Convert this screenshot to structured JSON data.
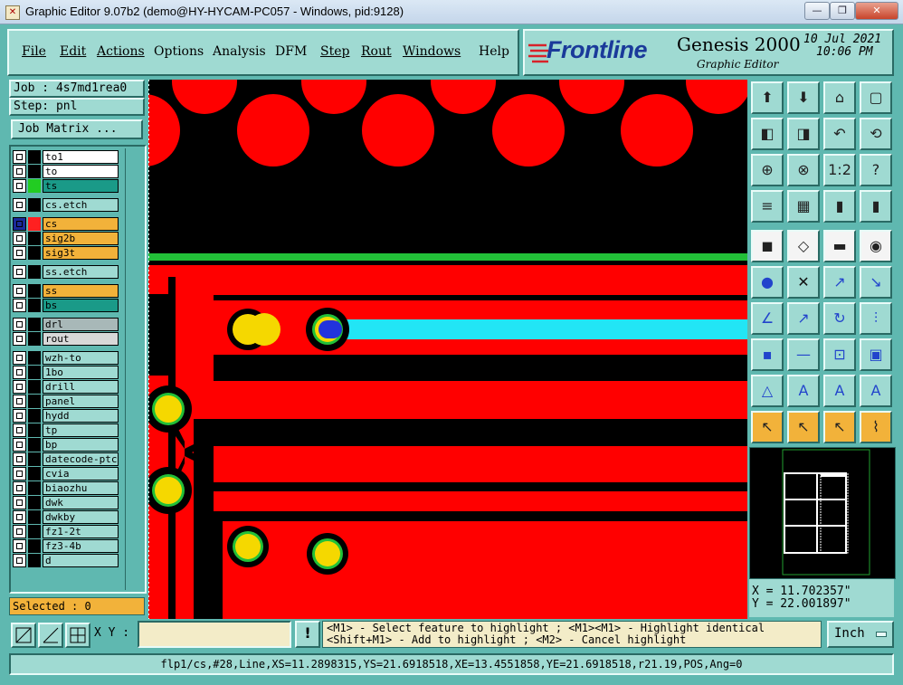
{
  "window": {
    "title": "Graphic Editor 9.07b2 (demo@HY-HYCAM-PC057 - Windows, pid:9128)"
  },
  "menu": {
    "file": "File",
    "edit": "Edit",
    "actions": "Actions",
    "options": "Options",
    "analysis": "Analysis",
    "dfm": "DFM",
    "step": "Step",
    "rout": "Rout",
    "windows": "Windows",
    "help": "Help"
  },
  "brand": {
    "logo": "Frontline",
    "product": "Genesis 2000",
    "subtitle": "Graphic Editor",
    "date": "10 Jul 2021",
    "time": "10:06 PM"
  },
  "job": {
    "job_label": "Job : 4s7md1rea0",
    "step_label": "Step: pnl",
    "matrix_button": "Job Matrix ..."
  },
  "layers": [
    {
      "name": "to1",
      "color": "#000000",
      "bg": "#ffffff"
    },
    {
      "name": "to",
      "color": "#000000",
      "bg": "#ffffff"
    },
    {
      "name": "ts",
      "color": "#22cc22",
      "bg": "#1a9a88"
    },
    {
      "name": "cs.etch",
      "color": "#000000",
      "bg": "#9fdad2"
    },
    {
      "name": "cs",
      "color": "#ff2020",
      "bg": "#f2b23a",
      "active": true
    },
    {
      "name": "sig2b",
      "color": "#000000",
      "bg": "#f2b23a"
    },
    {
      "name": "sig3t",
      "color": "#000000",
      "bg": "#f2b23a"
    },
    {
      "name": "ss.etch",
      "color": "#000000",
      "bg": "#9fdad2"
    },
    {
      "name": "ss",
      "color": "#000000",
      "bg": "#f2b23a"
    },
    {
      "name": "bs",
      "color": "#000000",
      "bg": "#1a9a88"
    },
    {
      "name": "drl",
      "color": "#000000",
      "bg": "#a8b8b8"
    },
    {
      "name": "rout",
      "color": "#000000",
      "bg": "#d8d8d8"
    },
    {
      "name": "wzh-to",
      "color": "#000000",
      "bg": "#9fdad2"
    },
    {
      "name": "1bo",
      "color": "#000000",
      "bg": "#9fdad2"
    },
    {
      "name": "drill",
      "color": "#000000",
      "bg": "#9fdad2"
    },
    {
      "name": "panel",
      "color": "#000000",
      "bg": "#9fdad2"
    },
    {
      "name": "hydd",
      "color": "#000000",
      "bg": "#9fdad2"
    },
    {
      "name": "tp",
      "color": "#000000",
      "bg": "#9fdad2"
    },
    {
      "name": "bp",
      "color": "#000000",
      "bg": "#9fdad2"
    },
    {
      "name": "datecode-ptc",
      "color": "#000000",
      "bg": "#9fdad2"
    },
    {
      "name": "cvia",
      "color": "#000000",
      "bg": "#9fdad2"
    },
    {
      "name": "biaozhu",
      "color": "#000000",
      "bg": "#9fdad2"
    },
    {
      "name": "dwk",
      "color": "#000000",
      "bg": "#9fdad2"
    },
    {
      "name": "dwkby",
      "color": "#000000",
      "bg": "#9fdad2"
    },
    {
      "name": "fz1-2t",
      "color": "#000000",
      "bg": "#9fdad2"
    },
    {
      "name": "fz3-4b",
      "color": "#000000",
      "bg": "#9fdad2"
    },
    {
      "name": "d",
      "color": "#000000",
      "bg": "#9fdad2"
    }
  ],
  "selected": "Selected : 0",
  "coords": {
    "x": "X  =  11.702357\"",
    "y": "Y  =  22.001897\""
  },
  "xy_label": "X Y :",
  "xy_value": "",
  "hint": {
    "line1": "<M1> - Select feature to highlight ; <M1><M1> - Highlight identical",
    "line2": "<Shift+M1> - Add to highlight ; <M2> - Cancel highlight"
  },
  "units": "Inch",
  "status": "flp1/cs,#28,Line,XS=11.2898315,YS=21.6918518,XE=13.4551858,YE=21.6918518,r21.19,POS,Ang=0",
  "colors": {
    "panel": "#9fdad2",
    "background": "#5fb8b0",
    "copper": "#ff0000",
    "pad": "#f5d800",
    "highlight_line": "#22e5f5"
  }
}
